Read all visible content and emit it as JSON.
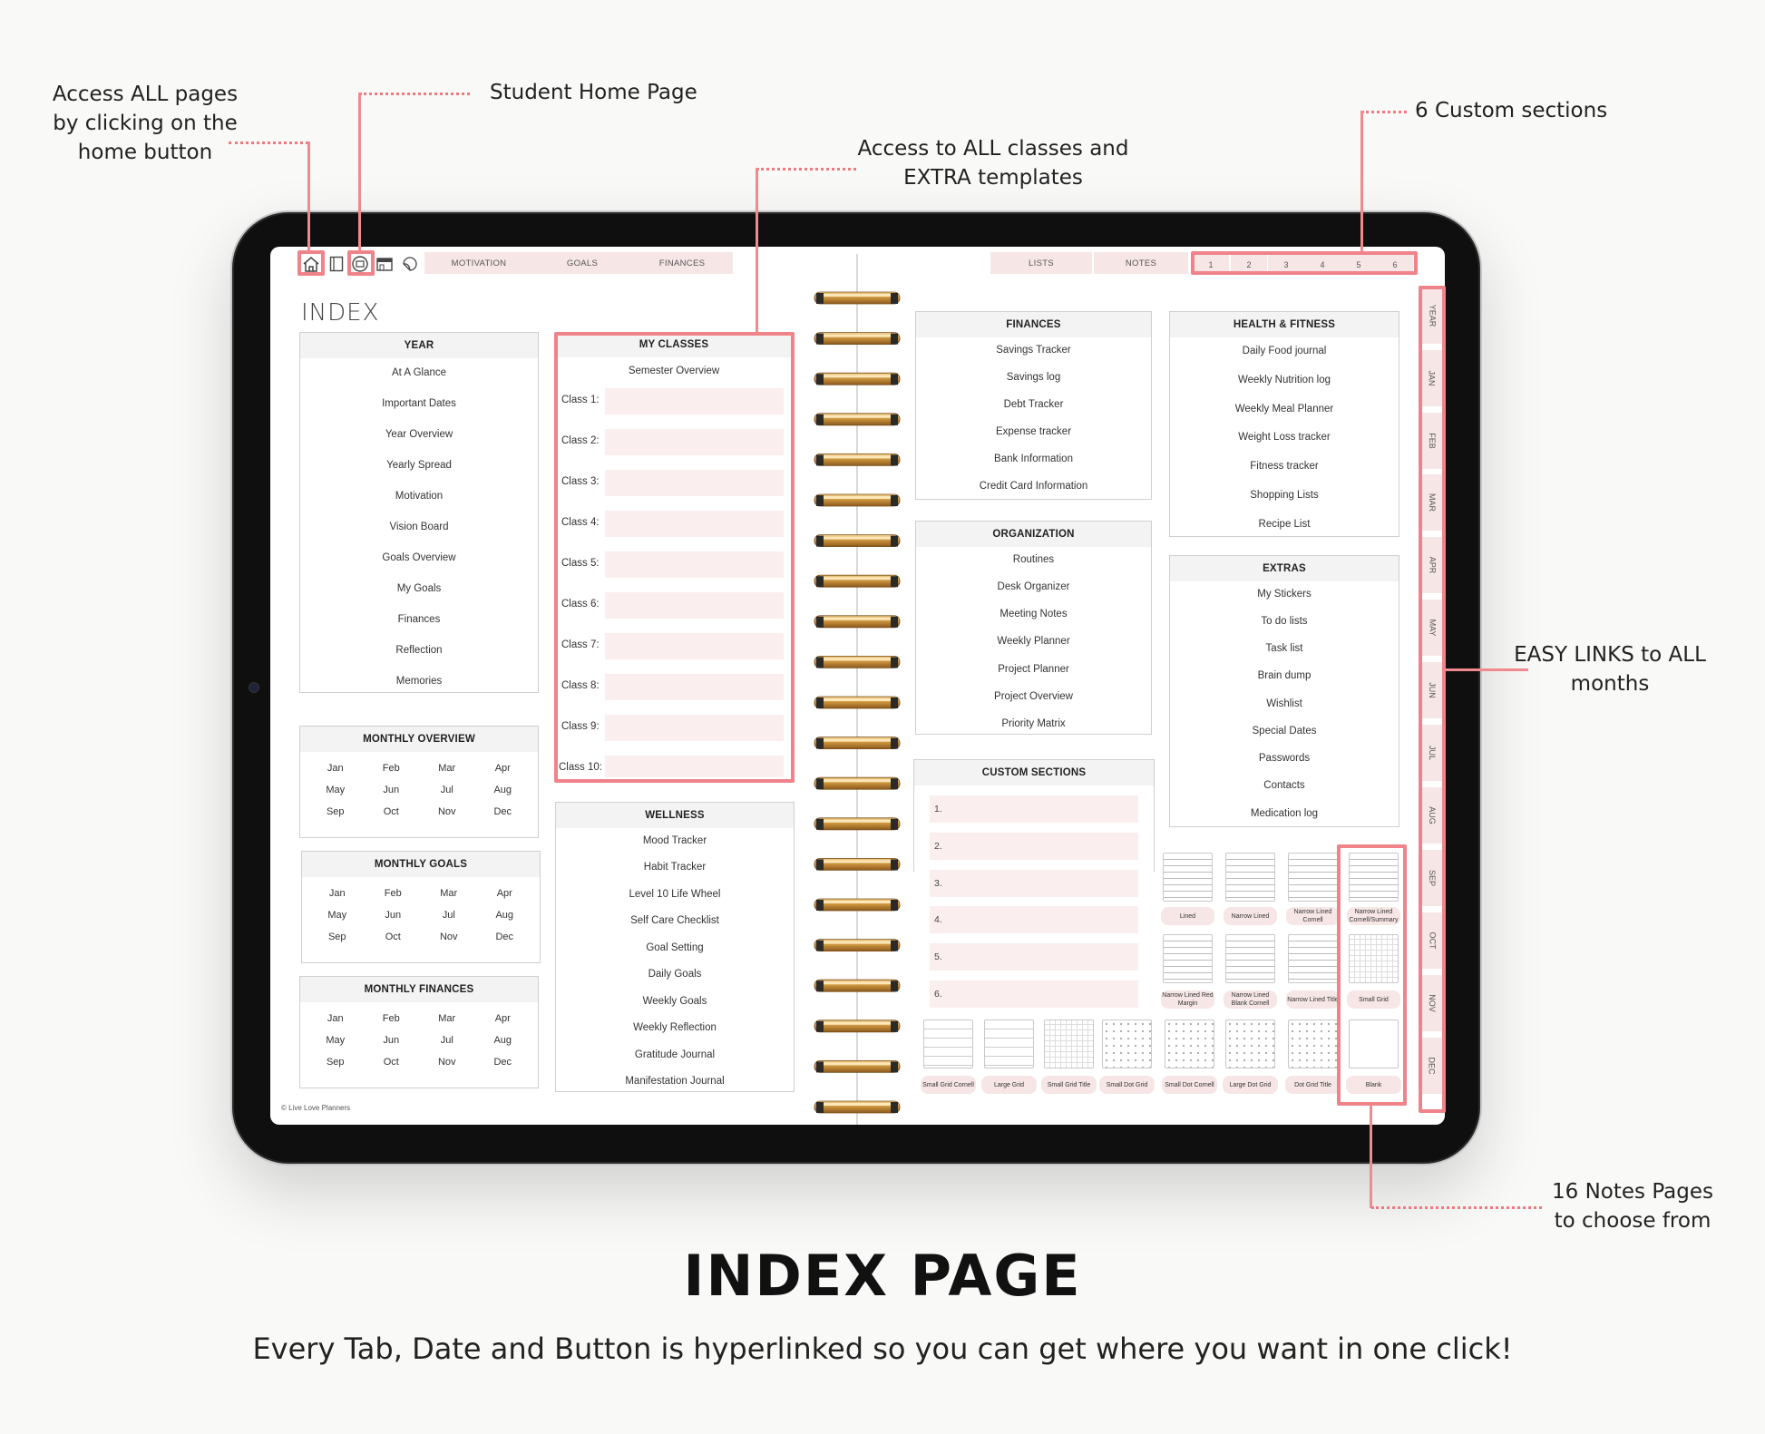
{
  "annotations": {
    "home_button": [
      "Access ALL pages",
      "by clicking on the",
      "home button"
    ],
    "student_home": "Student Home Page",
    "classes": [
      "Access to ALL classes and",
      "EXTRA templates"
    ],
    "custom_sections": "6 Custom sections",
    "months": [
      "EASY LINKS to ALL",
      "months"
    ],
    "notes": [
      "16 Notes Pages",
      "to choose from"
    ]
  },
  "topbar": {
    "left_tabs": [
      "MOTIVATION",
      "GOALS",
      "FINANCES"
    ],
    "right_tabs": [
      "LISTS",
      "NOTES"
    ],
    "number_tabs": [
      "1",
      "2",
      "3",
      "4",
      "5",
      "6"
    ],
    "icons": [
      "home-icon",
      "notebook-icon",
      "student-icon",
      "store-icon",
      "sticker-icon"
    ]
  },
  "month_tabs": [
    "YEAR",
    "JAN",
    "FEB",
    "MAR",
    "APR",
    "MAY",
    "JUN",
    "JUL",
    "AUG",
    "SEP",
    "OCT",
    "NOV",
    "DEC"
  ],
  "index": {
    "title": "INDEX",
    "year": {
      "header": "YEAR",
      "items": [
        "At A Glance",
        "Important Dates",
        "Year Overview",
        "Yearly  Spread",
        "Motivation",
        "Vision Board",
        "Goals Overview",
        "My Goals",
        "Finances",
        "Reflection",
        "Memories"
      ]
    },
    "months": [
      "Jan",
      "Feb",
      "Mar",
      "Apr",
      "May",
      "Jun",
      "Jul",
      "Aug",
      "Sep",
      "Oct",
      "Nov",
      "Dec"
    ],
    "monthly_overview": "MONTHLY OVERVIEW",
    "monthly_goals": "MONTHLY GOALS",
    "monthly_finances": "MONTHLY FINANCES",
    "copyright": "© Live Love Planners",
    "my_classes": {
      "header": "MY CLASSES",
      "overview": "Semester Overview",
      "classes": [
        "Class 1:",
        "Class 2:",
        "Class 3:",
        "Class 4:",
        "Class 5:",
        "Class 6:",
        "Class 7:",
        "Class 8:",
        "Class 9:",
        "Class 10:"
      ]
    },
    "wellness": {
      "header": "WELLNESS",
      "items": [
        "Mood Tracker",
        "Habit Tracker",
        "Level 10 Life Wheel",
        "Self Care Checklist",
        "Goal Setting",
        "Daily Goals",
        "Weekly Goals",
        "Weekly Reflection",
        "Gratitude Journal",
        "Manifestation Journal"
      ]
    },
    "finances": {
      "header": "FINANCES",
      "items": [
        "Savings Tracker",
        "Savings log",
        "Debt Tracker",
        "Expense tracker",
        "Bank Information",
        "Credit Card Information"
      ]
    },
    "organization": {
      "header": "ORGANIZATION",
      "items": [
        "Routines",
        "Desk Organizer",
        "Meeting Notes",
        "Weekly Planner",
        "Project Planner",
        "Project Overview",
        "Priority Matrix"
      ]
    },
    "custom_sections": {
      "header": "CUSTOM SECTIONS",
      "items": [
        "1.",
        "2.",
        "3.",
        "4.",
        "5.",
        "6."
      ]
    },
    "health": {
      "header": "HEALTH & FITNESS",
      "items": [
        "Daily Food journal",
        "Weekly Nutrition log",
        "Weekly Meal Planner",
        "Weight Loss tracker",
        "Fitness tracker",
        "Shopping Lists",
        "Recipe List"
      ]
    },
    "extras": {
      "header": "EXTRAS",
      "items": [
        "My Stickers",
        "To do lists",
        "Task list",
        "Brain dump",
        "Wishlist",
        "Special Dates",
        "Passwords",
        "Contacts",
        "Medication log"
      ]
    },
    "notes_templates": {
      "row1": [
        "Lined",
        "Narrow Lined",
        "Narrow Lined Cornell",
        "Narrow Lined Cornell/Summary"
      ],
      "row2": [
        "Narrow Lined Red Margin",
        "Narrow Lined Blank Cornell",
        "Narrow Lined Title",
        "Small Grid"
      ],
      "row3": [
        "Small Grid Cornell",
        "Large Grid",
        "Small Grid Title",
        "Small Dot Grid",
        "Small Dot Cornell",
        "Large Dot Grid",
        "Dot Grid Title",
        "Blank"
      ]
    }
  },
  "title": "INDEX PAGE",
  "subtitle": "Every Tab, Date and Button is hyperlinked so you can get where you want in one click!",
  "colors": {
    "accent": "#f0828a",
    "tab": "#f7e6e6",
    "row": "#fbeeee",
    "ring": "#d8a14a"
  }
}
